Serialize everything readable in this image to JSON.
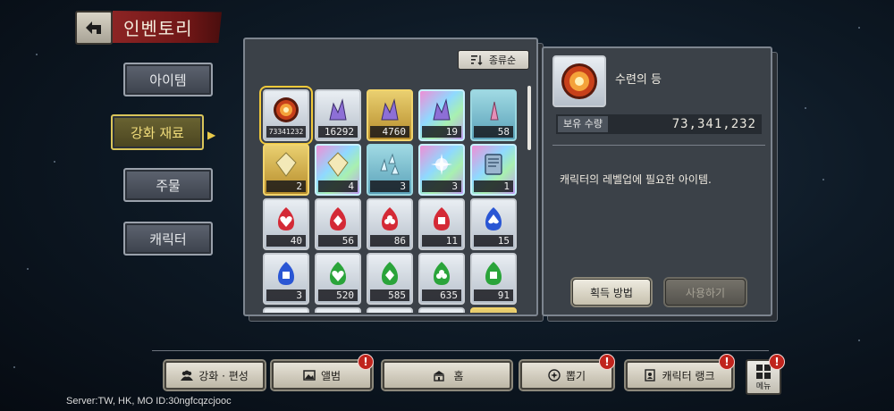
{
  "header": {
    "title": "인벤토리"
  },
  "sidebar": {
    "tabs": [
      {
        "label": "아이템",
        "active": false
      },
      {
        "label": "강화 재료",
        "active": true
      },
      {
        "label": "주물",
        "active": false
      },
      {
        "label": "캐릭터",
        "active": false
      }
    ]
  },
  "grid": {
    "sort_label": "종류순",
    "items": [
      {
        "count": "73341232",
        "rarity": "normal",
        "icon": "training-lamp-icon",
        "selected": true
      },
      {
        "count": "16292",
        "rarity": "normal",
        "icon": "crystal-icon"
      },
      {
        "count": "4760",
        "rarity": "gold",
        "icon": "crystal-icon"
      },
      {
        "count": "19",
        "rarity": "holo",
        "icon": "crystal-icon"
      },
      {
        "count": "58",
        "rarity": "teal",
        "icon": "shard-icon"
      },
      {
        "count": "2",
        "rarity": "gold",
        "icon": "gem-icon"
      },
      {
        "count": "4",
        "rarity": "holo",
        "icon": "gem-icon"
      },
      {
        "count": "3",
        "rarity": "teal",
        "icon": "shards-icon"
      },
      {
        "count": "3",
        "rarity": "holo",
        "icon": "flower-icon"
      },
      {
        "count": "1",
        "rarity": "holo",
        "icon": "book-icon"
      },
      {
        "count": "40",
        "rarity": "normal",
        "icon": "red-heart-flame-icon"
      },
      {
        "count": "56",
        "rarity": "normal",
        "icon": "red-diamond-flame-icon"
      },
      {
        "count": "86",
        "rarity": "normal",
        "icon": "red-club-flame-icon"
      },
      {
        "count": "11",
        "rarity": "normal",
        "icon": "red-square-flame-icon"
      },
      {
        "count": "15",
        "rarity": "normal",
        "icon": "blue-spade-flame-icon"
      },
      {
        "count": "3",
        "rarity": "normal",
        "icon": "blue-square-flame-icon"
      },
      {
        "count": "520",
        "rarity": "normal",
        "icon": "green-heart-flame-icon"
      },
      {
        "count": "585",
        "rarity": "normal",
        "icon": "green-diamond-flame-icon"
      },
      {
        "count": "635",
        "rarity": "normal",
        "icon": "green-club-flame-icon"
      },
      {
        "count": "91",
        "rarity": "normal",
        "icon": "green-square-flame-icon"
      },
      {
        "count": "",
        "rarity": "normal",
        "icon": "partial-item-icon"
      },
      {
        "count": "",
        "rarity": "normal",
        "icon": "partial-item-icon"
      },
      {
        "count": "",
        "rarity": "normal",
        "icon": "partial-item-icon"
      },
      {
        "count": "",
        "rarity": "normal",
        "icon": "partial-item-icon"
      },
      {
        "count": "",
        "rarity": "gold",
        "icon": "partial-item-icon"
      }
    ]
  },
  "detail": {
    "name": "수련의 등",
    "qty_label": "보유 수량",
    "qty_value": "73,341,232",
    "description": "캐릭터의 레벨업에 필요한 아이템.",
    "obtain_label": "획득 방법",
    "use_label": "사용하기"
  },
  "bottom_nav": {
    "items": [
      {
        "label": "강화 · 편성",
        "icon": "people-icon",
        "alert": false
      },
      {
        "label": "앨범",
        "icon": "album-icon",
        "alert": true
      },
      {
        "label": "홈",
        "icon": "home-icon",
        "alert": false
      },
      {
        "label": "뽑기",
        "icon": "gacha-icon",
        "alert": true
      },
      {
        "label": "캐릭터 랭크",
        "icon": "rank-icon",
        "alert": true
      }
    ],
    "menu_label": "메뉴",
    "badge_text": "!"
  },
  "server_info": "Server:TW, HK, MO ID:30ngfcqzcjooc",
  "colors": {
    "accent_gold": "#e8c94a",
    "title_red": "#8c2424",
    "alert_red": "#c0241d"
  }
}
